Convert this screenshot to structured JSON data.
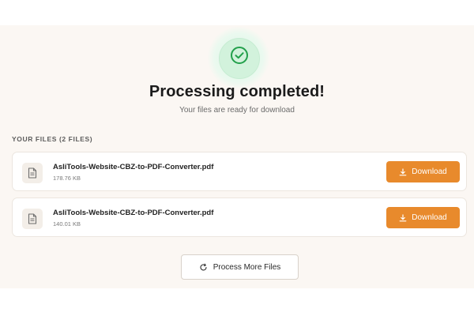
{
  "status": {
    "title": "Processing completed!",
    "subtitle": "Your files are ready for download",
    "icon": "check-circle-icon",
    "accent_color": "#22a04b"
  },
  "files_section": {
    "label": "YOUR FILES (2 FILES)"
  },
  "files": [
    {
      "name": "AsliTools-Website-CBZ-to-PDF-Converter.pdf",
      "size": "178.76 KB",
      "download_label": "Download"
    },
    {
      "name": "AsliTools-Website-CBZ-to-PDF-Converter.pdf",
      "size": "140.01 KB",
      "download_label": "Download"
    }
  ],
  "actions": {
    "process_more_label": "Process More Files"
  },
  "colors": {
    "download_button": "#e88a2c",
    "background": "#fbf7f3"
  }
}
